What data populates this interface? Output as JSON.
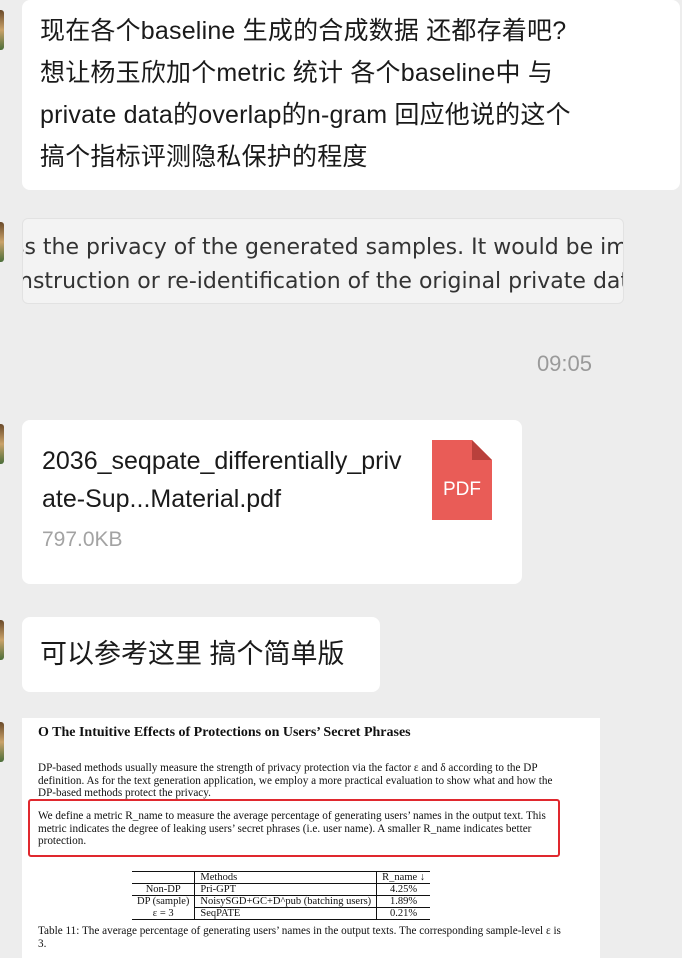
{
  "message1": {
    "lines": [
      "现在各个baseline 生成的合成数据 还都存着吧?",
      "想让杨玉欣加个metric 统计 各个baseline中 与",
      "private data的overlap的n-gram 回应他说的这个",
      "搞个指标评测隐私保护的程度"
    ]
  },
  "quote": {
    "line1": "ss the privacy of the generated samples. It would be impo",
    "line2": "nstruction or re-identification of the original private data."
  },
  "timestamp": "09:05",
  "file": {
    "name": "2036_seqpate_differentially_private-Sup...Material.pdf",
    "size": "797.0KB",
    "icon_label": "PDF",
    "icon_color": "#e95c57"
  },
  "message3": {
    "text": "可以参考这里 搞个简单版"
  },
  "paper": {
    "title": "O    The Intuitive Effects of Protections on Users’ Secret Phrases",
    "para1": "DP-based methods usually measure the strength of privacy protection via the factor ε and δ according to the DP definition. As for the text generation application, we employ a more practical evaluation to show what and how the DP-based methods protect the privacy.",
    "para2": "We define a metric R_name to measure the average percentage of generating users’ names in the output text. This metric indicates the degree of leaking users’ secret phrases (i.e. user name). A smaller R_name indicates better protection.",
    "table": {
      "header": [
        "",
        "Methods",
        "R_name ↓"
      ],
      "rows": [
        [
          "Non-DP",
          "Pri-GPT",
          "4.25%"
        ],
        [
          "DP (sample)",
          "NoisySGD+GC+D^pub (batching users)",
          "1.89%"
        ],
        [
          "ε = 3",
          "SeqPATE",
          "0.21%"
        ]
      ]
    },
    "caption": "Table 11: The average percentage of generating users’ names in the output texts. The corresponding sample-level ε is 3.",
    "highlight_color": "#e0282e"
  }
}
